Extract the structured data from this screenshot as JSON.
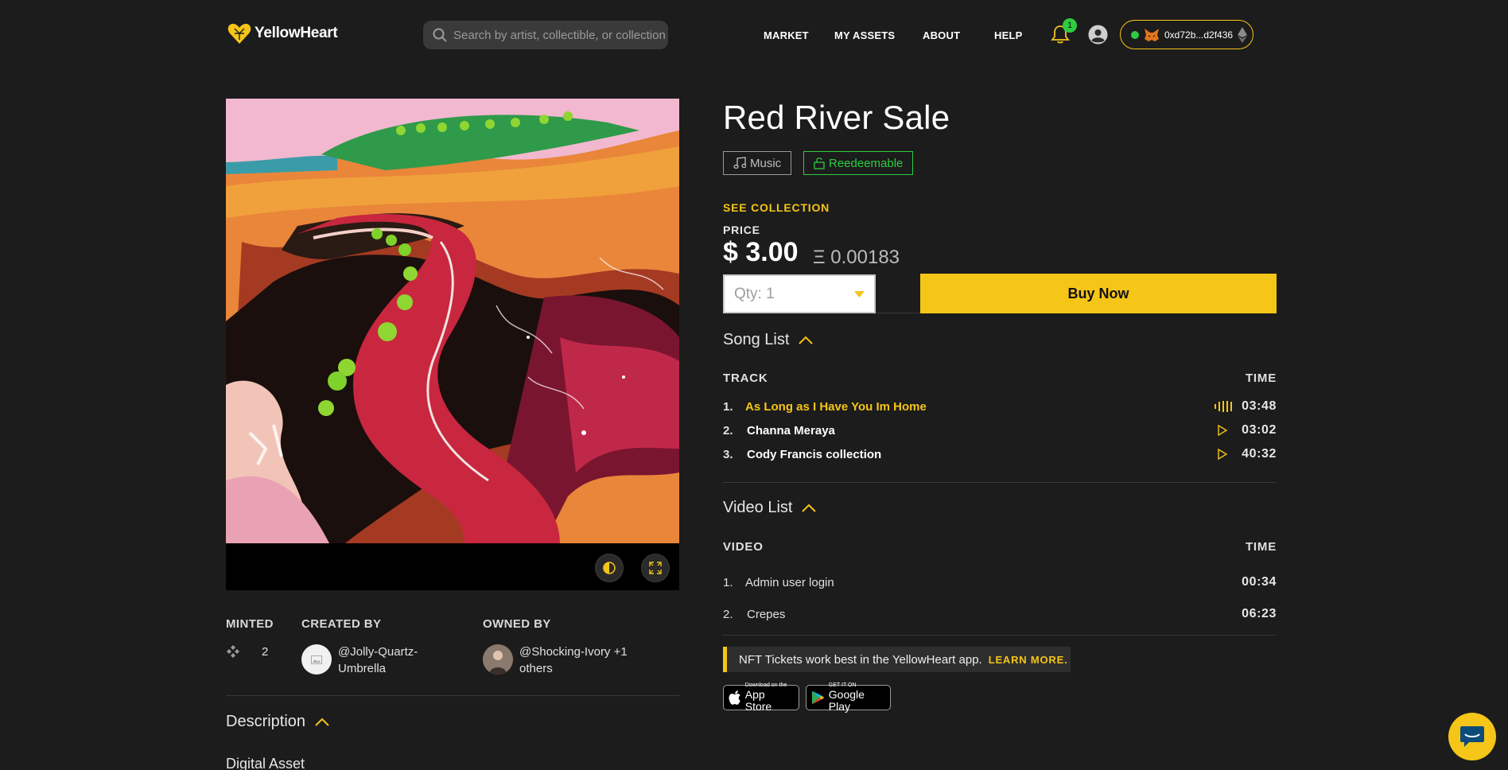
{
  "header": {
    "logo_text": "YellowHeart",
    "search_placeholder": "Search by artist, collectible, or collection",
    "nav": [
      "MARKET",
      "MY ASSETS",
      "ABOUT",
      "HELP"
    ],
    "notification_count": "1",
    "wallet_address": "0xd72b...d2f436",
    "wallet_status_color": "#2ecc40"
  },
  "item": {
    "title": "Red River Sale",
    "tags": [
      "Music",
      "Reedeemable"
    ],
    "see_collection": "SEE COLLECTION",
    "price_label": "PRICE",
    "price_usd": "$ 3.00",
    "price_eth": "Ξ 0.00183",
    "qty_label": "Qty: 1",
    "buy_label": "Buy Now"
  },
  "song_list": {
    "title": "Song List",
    "col_track": "TRACK",
    "col_time": "TIME",
    "tracks": [
      {
        "num": "1.",
        "name": "As Long as I Have You Im Home",
        "time": "03:48",
        "playing": true
      },
      {
        "num": "2.",
        "name": "Channa Meraya",
        "time": "03:02",
        "playing": false
      },
      {
        "num": "3.",
        "name": "Cody Francis collection",
        "time": "40:32",
        "playing": false
      }
    ]
  },
  "video_list": {
    "title": "Video List",
    "col_video": "VIDEO",
    "col_time": "TIME",
    "videos": [
      {
        "num": "1.",
        "name": "Admin user login",
        "time": "00:34"
      },
      {
        "num": "2.",
        "name": "Crepes",
        "time": "06:23"
      }
    ]
  },
  "banner": {
    "text": "NFT Tickets work best in the YellowHeart app.",
    "link": "LEARN MORE."
  },
  "stores": {
    "apple_small": "Download on the",
    "apple_big": "App Store",
    "google_small": "GET IT ON",
    "google_big": "Google Play"
  },
  "meta": {
    "minted_label": "MINTED",
    "minted_value": "2",
    "created_label": "CREATED BY",
    "created_by": "@Jolly-Quartz-Umbrella",
    "owned_label": "OWNED BY",
    "owned_by": "@Shocking-Ivory +1 others"
  },
  "description": {
    "title": "Description",
    "text": "Digital Asset"
  },
  "colors": {
    "accent": "#f5c518",
    "background": "#1c1c1c",
    "redeemable": "#2ecc40"
  }
}
